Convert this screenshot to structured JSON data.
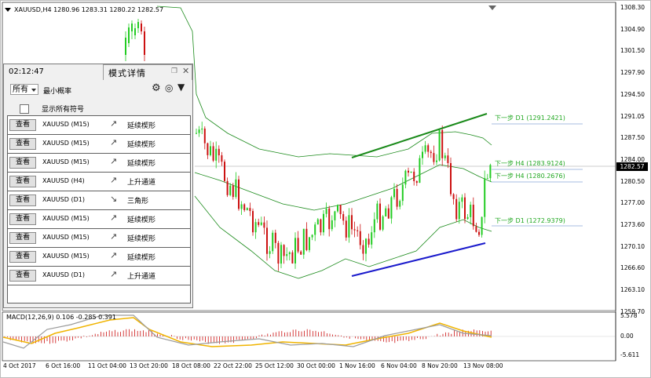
{
  "title": "XAUUSD,H4  1280.96 1283.31 1280.22 1282.57",
  "macd_label": "MACD(12,26,9) 0.106 -0.285 0.391",
  "current_price": "1282.57",
  "y_axis_labels": [
    "1308.30",
    "1304.90",
    "1301.50",
    "1297.90",
    "1294.50",
    "1291.05",
    "1287.50",
    "1284.00",
    "1280.50",
    "1277.00",
    "1273.60",
    "1270.10",
    "1266.60",
    "1263.10",
    "1259.70"
  ],
  "macd_axis_labels": [
    "5.578",
    "0.00",
    "-5.611"
  ],
  "x_axis_labels": [
    "4 Oct 2017",
    "6 Oct 16:00",
    "11 Oct 04:00",
    "13 Oct 20:00",
    "18 Oct 08:00",
    "22 Oct 22:00",
    "25 Oct 12:00",
    "30 Oct 00:00",
    "1 Nov 16:00",
    "6 Nov 04:00",
    "8 Nov 20:00",
    "13 Nov 08:00"
  ],
  "levels": [
    {
      "text": "下一步 D1 (1291.2421)",
      "color": "#22a822"
    },
    {
      "text": "下一步 H4 (1283.9124)",
      "color": "#22a822"
    },
    {
      "text": "下一步 H4 (1280.2676)",
      "color": "#22a822"
    },
    {
      "text": "下一步 D1 (1272.9379)",
      "color": "#22a822"
    }
  ],
  "colors": {
    "bull": "#22cc22",
    "bear": "#cc1111",
    "upper_trend": "#1a8a1a",
    "lower_trend": "#1a1acc",
    "macd_signal": "#f0b400"
  },
  "panel": {
    "time": "02:12:47",
    "tab_title": "模式详情",
    "filter_value": "所有",
    "min_prob_label": "最小概率",
    "show_all_label": "显示所有符号",
    "icons": [
      "gear-icon",
      "globe-icon",
      "filter-icon",
      "pin-icon",
      "close-icon"
    ],
    "rows": [
      {
        "button": "查看",
        "symbol": "XAUUSD (M15)",
        "pattern": "延续楔形",
        "icon": "up"
      },
      {
        "button": "查看",
        "symbol": "XAUUSD (M15)",
        "pattern": "延续楔形",
        "icon": "up"
      },
      {
        "button": "查看",
        "symbol": "XAUUSD (M15)",
        "pattern": "延续楔形",
        "icon": "up"
      },
      {
        "button": "查看",
        "symbol": "XAUUSD (H4)",
        "pattern": "上升通道",
        "icon": "up"
      },
      {
        "button": "查看",
        "symbol": "XAUUSD (D1)",
        "pattern": "三角形",
        "icon": "down"
      },
      {
        "button": "查看",
        "symbol": "XAUUSD (M15)",
        "pattern": "延续楔形",
        "icon": "up"
      },
      {
        "button": "查看",
        "symbol": "XAUUSD (M15)",
        "pattern": "延续楔形",
        "icon": "up"
      },
      {
        "button": "查看",
        "symbol": "XAUUSD (M15)",
        "pattern": "延续楔形",
        "icon": "up"
      },
      {
        "button": "查看",
        "symbol": "XAUUSD (D1)",
        "pattern": "上升通道",
        "icon": "up"
      }
    ]
  }
}
